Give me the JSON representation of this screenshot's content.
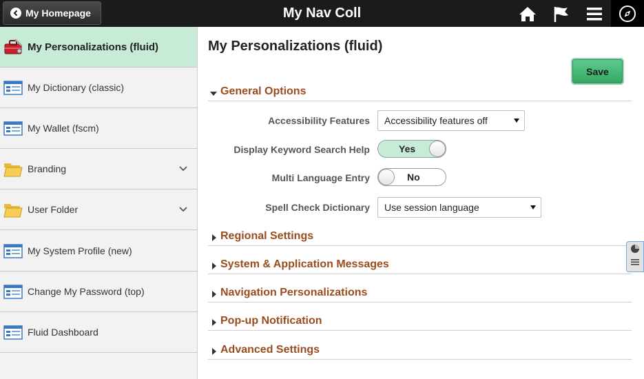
{
  "header": {
    "home_button_label": "My Homepage",
    "title": "My Nav Coll",
    "icons": [
      "home-icon",
      "flag-icon",
      "menu-icon",
      "navbar-compass-icon"
    ],
    "bg_color": "#1b1b1b"
  },
  "sidebar": {
    "items": [
      {
        "label": "My Personalizations (fluid)",
        "icon": "toolbox-icon",
        "active": true
      },
      {
        "label": "My Dictionary (classic)",
        "icon": "page-icon"
      },
      {
        "label": "My Wallet (fscm)",
        "icon": "page-icon"
      },
      {
        "label": "Branding",
        "icon": "folder-icon",
        "expandable": true
      },
      {
        "label": "User Folder",
        "icon": "folder-icon",
        "expandable": true
      },
      {
        "label": "My System Profile (new)",
        "icon": "page-icon"
      },
      {
        "label": "Change My Password (top)",
        "icon": "page-icon"
      },
      {
        "label": "Fluid Dashboard",
        "icon": "page-icon"
      }
    ],
    "active_color": "#c8ebd7"
  },
  "main": {
    "title": "My Personalizations (fluid)",
    "save_label": "Save",
    "sections": [
      {
        "label": "General Options",
        "expanded": true
      },
      {
        "label": "Regional Settings",
        "expanded": false
      },
      {
        "label": "System & Application Messages",
        "expanded": false
      },
      {
        "label": "Navigation Personalizations",
        "expanded": false
      },
      {
        "label": "Pop-up Notification",
        "expanded": false
      },
      {
        "label": "Advanced Settings",
        "expanded": false
      }
    ],
    "fields": {
      "accessibility": {
        "label": "Accessibility Features",
        "value": "Accessibility features off"
      },
      "keyword_help": {
        "label": "Display Keyword Search Help",
        "value": "Yes",
        "on": true
      },
      "multi_lang": {
        "label": "Multi Language Entry",
        "value": "No",
        "on": false
      },
      "spell_check": {
        "label": "Spell Check Dictionary",
        "value": "Use session language"
      }
    },
    "section_color": "#9a4c1e",
    "save_color": "#34a863"
  }
}
